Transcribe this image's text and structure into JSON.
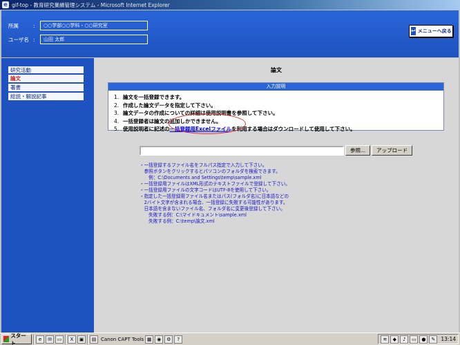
{
  "window": {
    "title": "gif-top - 教育研究業績管理システム - Microsoft Internet Explorer"
  },
  "header": {
    "affiliation_label": "所属",
    "affiliation_value": "○○学部○○学科・○○研究室",
    "user_label": "ユーザ名",
    "user_value": "山田 太郎",
    "menu_button": "メニューへ戻る"
  },
  "sidebar": {
    "items": [
      {
        "label": "研究活動"
      },
      {
        "label": "論文"
      },
      {
        "label": "著書"
      },
      {
        "label": "総説・解説記事"
      }
    ]
  },
  "main": {
    "title": "論文",
    "panel_header": "入力説明",
    "steps": [
      {
        "num": "1.",
        "text": "論文を一括登録できます。"
      },
      {
        "num": "2.",
        "text": "作成した論文データを指定して下さい。"
      },
      {
        "num": "3.",
        "text": "論文データの作成についての詳細は使用説明書を参照して下さい。"
      },
      {
        "num": "4.",
        "text": "一括登録者は論文の追加しかできません。"
      },
      {
        "num": "5.",
        "pre": "使用説明者に記述の",
        "link": "一括登録用Excelファイル",
        "post": "を利用する場合はダウンロードして使用して下さい。"
      }
    ],
    "browse_button": "参照...",
    "upload_button": "アップロード",
    "notes": [
      "・一括登録するファイル名をフルパス指定で入力して下さい。",
      "　参照ボタンをクリックするとパソコンのフォルダを検索できます。",
      "　　例：C:\\Documents and Settings\\temp\\sample.xml",
      "・一括登録用ファイルはXML形式のテキストファイルで登録して下さい。",
      "・一括登録用ファイルの文字コードはUTF-8を使用して下さい。",
      "・指定した一括登録用ファイル名またはパス(フォルダ名)に日本語などの",
      "　2バイト文字が含まれる場合、一括登録に失敗する可能性があります。",
      "　日本語を含まないファイル名、フォルダ名に変更後登録して下さい。",
      "　　失敗する例：C:\\マイドキュメント\\sample.xml",
      "　　失敗する例：C:\\temp\\論文.xml"
    ]
  },
  "taskbar": {
    "start_label": "スタート",
    "program_label": "Canon CAPT Tools",
    "clock": "13:14"
  }
}
